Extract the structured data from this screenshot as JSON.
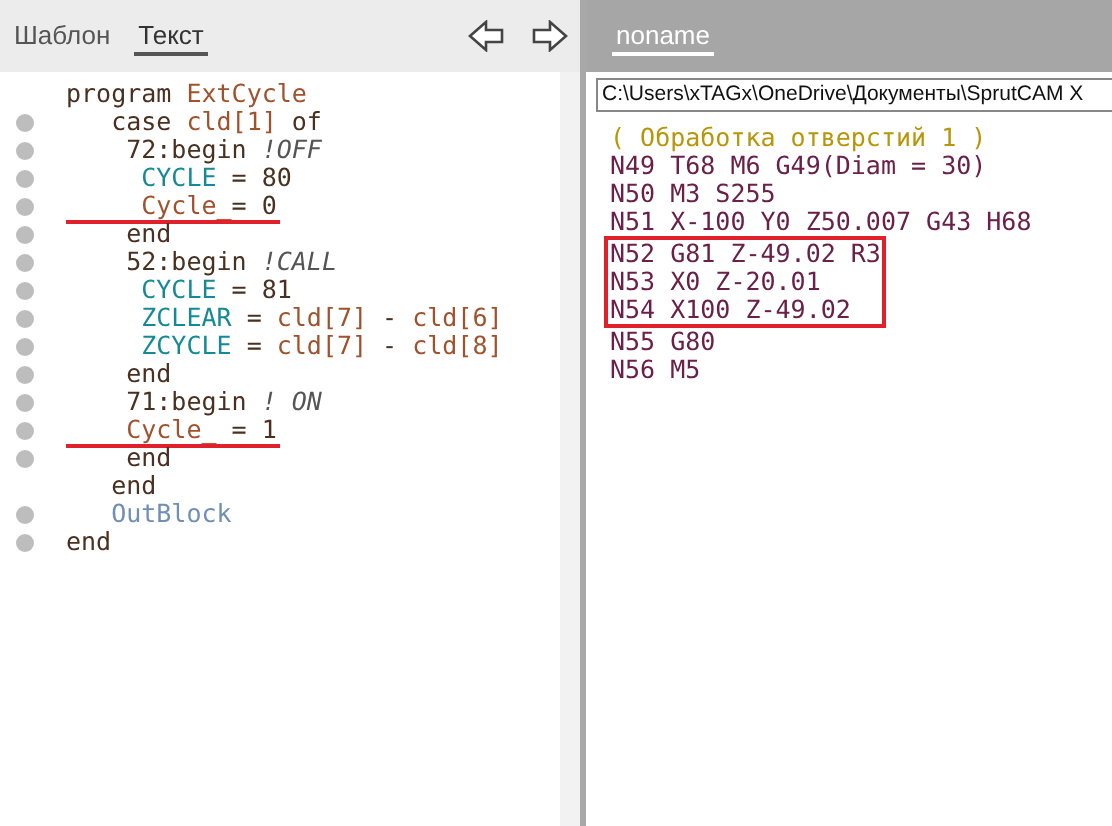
{
  "left_panel": {
    "tabs": [
      {
        "label": "Шаблон",
        "selected": false
      },
      {
        "label": "Текст",
        "selected": true
      }
    ],
    "lines": [
      {
        "marker": false,
        "underlined": false,
        "segments": [
          {
            "text": "program ",
            "kind": "keyword"
          },
          {
            "text": "ExtCycle",
            "kind": "ident"
          }
        ]
      },
      {
        "marker": true,
        "underlined": false,
        "segments": [
          {
            "text": "   case ",
            "kind": "keyword"
          },
          {
            "text": "cld[1]",
            "kind": "ident"
          },
          {
            "text": " of",
            "kind": "keyword"
          }
        ]
      },
      {
        "marker": true,
        "underlined": false,
        "segments": [
          {
            "text": "    72:begin ",
            "kind": "keyword"
          },
          {
            "text": "!OFF",
            "kind": "comment"
          }
        ]
      },
      {
        "marker": true,
        "underlined": false,
        "segments": [
          {
            "text": "     CYCLE",
            "kind": "variable"
          },
          {
            "text": " = 80",
            "kind": "keyword"
          }
        ]
      },
      {
        "marker": true,
        "underlined": true,
        "segments": [
          {
            "text": "     Cycle_",
            "kind": "ident"
          },
          {
            "text": "= 0",
            "kind": "keyword"
          }
        ]
      },
      {
        "marker": true,
        "underlined": false,
        "segments": [
          {
            "text": "    end",
            "kind": "keyword"
          }
        ]
      },
      {
        "marker": true,
        "underlined": false,
        "segments": [
          {
            "text": "    52:begin ",
            "kind": "keyword"
          },
          {
            "text": "!CALL",
            "kind": "comment"
          }
        ]
      },
      {
        "marker": true,
        "underlined": false,
        "segments": [
          {
            "text": "     CYCLE",
            "kind": "variable"
          },
          {
            "text": " = 81",
            "kind": "keyword"
          }
        ]
      },
      {
        "marker": true,
        "underlined": false,
        "segments": [
          {
            "text": "     ZCLEAR",
            "kind": "variable"
          },
          {
            "text": " = ",
            "kind": "keyword"
          },
          {
            "text": "cld[7]",
            "kind": "ident"
          },
          {
            "text": " - ",
            "kind": "keyword"
          },
          {
            "text": "cld[6]",
            "kind": "ident"
          }
        ]
      },
      {
        "marker": true,
        "underlined": false,
        "segments": [
          {
            "text": "     ZCYCLE",
            "kind": "variable"
          },
          {
            "text": " = ",
            "kind": "keyword"
          },
          {
            "text": "cld[7]",
            "kind": "ident"
          },
          {
            "text": " - ",
            "kind": "keyword"
          },
          {
            "text": "cld[8]",
            "kind": "ident"
          }
        ]
      },
      {
        "marker": true,
        "underlined": false,
        "segments": [
          {
            "text": "    end",
            "kind": "keyword"
          }
        ]
      },
      {
        "marker": true,
        "underlined": false,
        "segments": [
          {
            "text": "    71:begin ",
            "kind": "keyword"
          },
          {
            "text": "! ON",
            "kind": "comment"
          }
        ]
      },
      {
        "marker": true,
        "underlined": true,
        "segments": [
          {
            "text": "    Cycle_",
            "kind": "ident"
          },
          {
            "text": " = 1",
            "kind": "keyword"
          }
        ]
      },
      {
        "marker": true,
        "underlined": false,
        "segments": [
          {
            "text": "    end",
            "kind": "keyword"
          }
        ]
      },
      {
        "marker": false,
        "underlined": false,
        "segments": [
          {
            "text": "   end",
            "kind": "keyword"
          }
        ]
      },
      {
        "marker": true,
        "underlined": false,
        "segments": [
          {
            "text": "   OutBlock",
            "kind": "call"
          }
        ]
      },
      {
        "marker": true,
        "underlined": false,
        "segments": [
          {
            "text": "end",
            "kind": "keyword"
          }
        ]
      }
    ]
  },
  "right_panel": {
    "tabs": [
      {
        "label": "noname",
        "selected": true
      }
    ],
    "path": "C:\\Users\\xTAGx\\OneDrive\\Документы\\SprutCAM X",
    "blocks": [
      {
        "framed": false,
        "lines": [
          {
            "text": "( Обработка отверстий 1 )",
            "kind": "comment"
          },
          {
            "text": "N49 T68 M6 G49(Diam = 30)",
            "kind": "code"
          },
          {
            "text": "N50 M3 S255",
            "kind": "code"
          },
          {
            "text": "N51 X-100 Y0 Z50.007 G43 H68",
            "kind": "code"
          }
        ]
      },
      {
        "framed": true,
        "lines": [
          {
            "text": "N52 G81 Z-49.02 R3",
            "kind": "code"
          },
          {
            "text": "N53 X0 Z-20.01",
            "kind": "code"
          },
          {
            "text": "N54 X100 Z-49.02",
            "kind": "code"
          }
        ]
      },
      {
        "framed": false,
        "lines": [
          {
            "text": "N55 G80",
            "kind": "code"
          },
          {
            "text": "N56 M5",
            "kind": "code"
          }
        ]
      }
    ]
  }
}
